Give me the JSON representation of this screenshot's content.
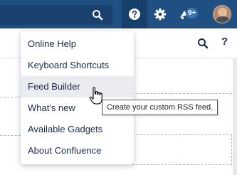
{
  "header": {
    "search_icon": "search-icon",
    "help_icon": "question-mark-icon",
    "settings_icon": "gear-icon",
    "notifications_icon": "notification-icon",
    "notification_badge": "9+",
    "avatar_icon": "user-avatar"
  },
  "page_toolbar": {
    "search_icon": "search-icon",
    "help_label": "?"
  },
  "help_menu": {
    "items": [
      {
        "label": "Online Help"
      },
      {
        "label": "Keyboard Shortcuts"
      },
      {
        "label": "Feed Builder"
      },
      {
        "label": "What's new"
      },
      {
        "label": "Available Gadgets"
      },
      {
        "label": "About Confluence"
      }
    ],
    "active_index": 2
  },
  "tooltip": {
    "text": "Create your custom RSS feed."
  },
  "colors": {
    "header_bg": "#205081",
    "accent": "#3572b0",
    "menu_hover": "#ebecf0"
  }
}
